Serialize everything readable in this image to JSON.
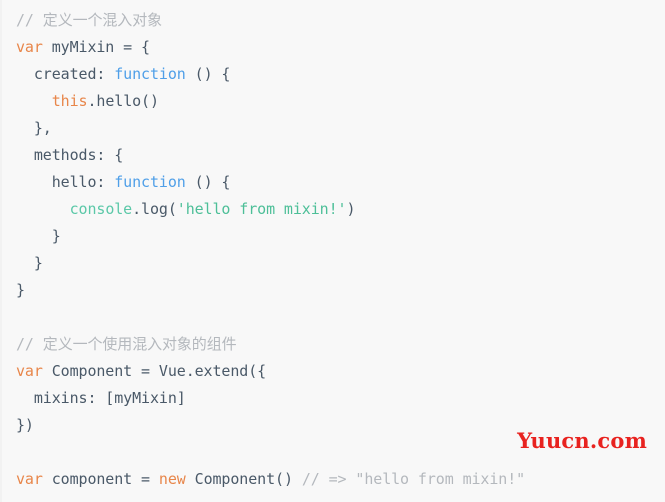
{
  "theme": {
    "background": "#f8f8f8",
    "default_text": "#4a5968",
    "comment": "#b4b8bd",
    "keyword": "#e8864a",
    "function": "#4f9fe8",
    "builtin": "#5bc8a8",
    "string": "#4dbf98",
    "watermark": "#e8221f"
  },
  "watermark": {
    "text": "Yuucn.com"
  },
  "code": {
    "language": "javascript",
    "lines": [
      {
        "index": 1,
        "text": "// 定义一个混入对象",
        "tokens": [
          {
            "text": "// ",
            "type": "comment"
          },
          {
            "text": "定义一个混入对象",
            "type": "comment",
            "cjk": true
          }
        ]
      },
      {
        "index": 2,
        "text": "var myMixin = {",
        "tokens": [
          {
            "text": "var",
            "type": "keyword"
          },
          {
            "text": " myMixin = {",
            "type": "plain"
          }
        ]
      },
      {
        "index": 3,
        "text": "  created: function () {",
        "tokens": [
          {
            "text": "  created: ",
            "type": "plain"
          },
          {
            "text": "function",
            "type": "function"
          },
          {
            "text": " () {",
            "type": "plain"
          }
        ]
      },
      {
        "index": 4,
        "text": "    this.hello()",
        "tokens": [
          {
            "text": "    ",
            "type": "plain"
          },
          {
            "text": "this",
            "type": "keyword"
          },
          {
            "text": ".hello()",
            "type": "plain"
          }
        ]
      },
      {
        "index": 5,
        "text": "  },",
        "tokens": [
          {
            "text": "  },",
            "type": "plain"
          }
        ]
      },
      {
        "index": 6,
        "text": "  methods: {",
        "tokens": [
          {
            "text": "  methods: {",
            "type": "plain"
          }
        ]
      },
      {
        "index": 7,
        "text": "    hello: function () {",
        "tokens": [
          {
            "text": "    hello: ",
            "type": "plain"
          },
          {
            "text": "function",
            "type": "function"
          },
          {
            "text": " () {",
            "type": "plain"
          }
        ]
      },
      {
        "index": 8,
        "text": "      console.log('hello from mixin!')",
        "tokens": [
          {
            "text": "      ",
            "type": "plain"
          },
          {
            "text": "console",
            "type": "builtin"
          },
          {
            "text": ".log(",
            "type": "plain"
          },
          {
            "text": "'hello from mixin!'",
            "type": "string"
          },
          {
            "text": ")",
            "type": "plain"
          }
        ]
      },
      {
        "index": 9,
        "text": "    }",
        "tokens": [
          {
            "text": "    }",
            "type": "plain"
          }
        ]
      },
      {
        "index": 10,
        "text": "  }",
        "tokens": [
          {
            "text": "  }",
            "type": "plain"
          }
        ]
      },
      {
        "index": 11,
        "text": "}",
        "tokens": [
          {
            "text": "}",
            "type": "plain"
          }
        ]
      },
      {
        "index": 12,
        "text": "",
        "tokens": []
      },
      {
        "index": 13,
        "text": "// 定义一个使用混入对象的组件",
        "tokens": [
          {
            "text": "// ",
            "type": "comment"
          },
          {
            "text": "定义一个使用混入对象的组件",
            "type": "comment",
            "cjk": true
          }
        ]
      },
      {
        "index": 14,
        "text": "var Component = Vue.extend({",
        "tokens": [
          {
            "text": "var",
            "type": "keyword"
          },
          {
            "text": " Component = Vue.extend({",
            "type": "plain"
          }
        ]
      },
      {
        "index": 15,
        "text": "  mixins: [myMixin]",
        "tokens": [
          {
            "text": "  mixins: [myMixin]",
            "type": "plain"
          }
        ]
      },
      {
        "index": 16,
        "text": "})",
        "tokens": [
          {
            "text": "})",
            "type": "plain"
          }
        ]
      },
      {
        "index": 17,
        "text": "",
        "tokens": []
      },
      {
        "index": 18,
        "text": "var component = new Component() // => \"hello from mixin!\"",
        "tokens": [
          {
            "text": "var",
            "type": "keyword"
          },
          {
            "text": " component = ",
            "type": "plain"
          },
          {
            "text": "new",
            "type": "keyword"
          },
          {
            "text": " Component() ",
            "type": "plain"
          },
          {
            "text": "// => \"hello from mixin!\"",
            "type": "comment"
          }
        ]
      }
    ]
  }
}
